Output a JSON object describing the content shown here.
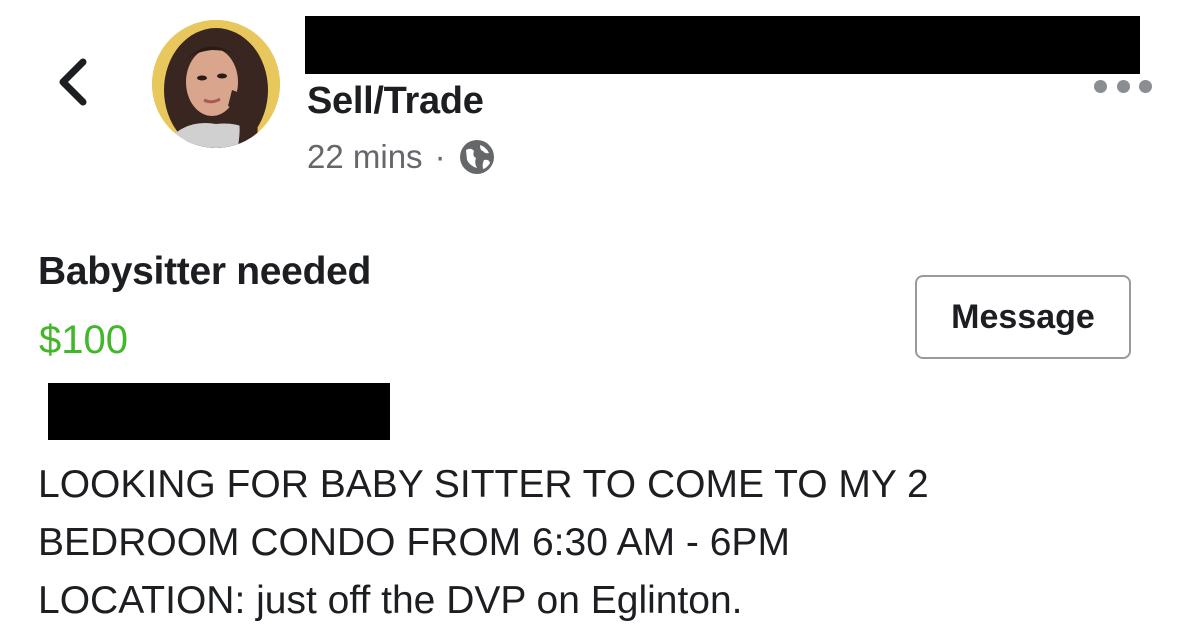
{
  "post": {
    "group_name": "Sell/Trade",
    "time": "22 mins",
    "separator": "·",
    "audience_icon": "globe-icon"
  },
  "listing": {
    "title": "Babysitter needed",
    "price": "$100",
    "message_button": "Message",
    "description_lines": [
      "LOOKING FOR BABY SITTER TO COME TO MY 2",
      "BEDROOM CONDO FROM 6:30 AM - 6PM",
      "LOCATION: just off the DVP on Eglinton."
    ]
  },
  "icons": {
    "back": "chevron-left-icon",
    "more": "more-options-icon"
  },
  "colors": {
    "price": "#42b72a",
    "text": "#1c1e21",
    "secondary": "#65676b",
    "redaction": "#000000"
  }
}
